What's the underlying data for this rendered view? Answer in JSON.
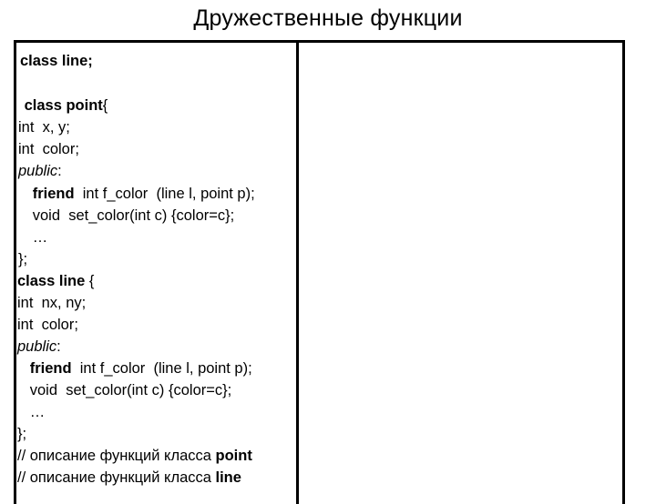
{
  "title": "Дружественные функции",
  "left_cell": {
    "lines": [
      {
        "parts": [
          {
            "text": "class line;",
            "style": "b"
          }
        ]
      },
      {
        "parts": [
          {
            "text": " class point",
            "style": "b"
          },
          {
            "text": "{",
            "style": ""
          }
        ]
      },
      {
        "parts": [
          {
            "text": "int  x, y;",
            "style": ""
          }
        ]
      },
      {
        "parts": [
          {
            "text": "int  color;",
            "style": ""
          }
        ]
      },
      {
        "parts": [
          {
            "text": "public",
            "style": "i"
          },
          {
            "text": ":",
            "style": ""
          }
        ]
      },
      {
        "parts": [
          {
            "text": "   friend",
            "style": "b"
          },
          {
            "text": "  int f_color  (line l, point p);",
            "style": ""
          }
        ]
      },
      {
        "parts": [
          {
            "text": "   void  set_color(int c) {color=c};",
            "style": ""
          }
        ]
      },
      {
        "parts": [
          {
            "text": "   …",
            "style": ""
          }
        ]
      },
      {
        "parts": [
          {
            "text": "};",
            "style": ""
          }
        ]
      },
      {
        "parts": [
          {
            "text": "class line",
            "style": "b"
          },
          {
            "text": " {",
            "style": ""
          }
        ]
      },
      {
        "parts": [
          {
            "text": "int  nx, ny;",
            "style": ""
          }
        ]
      },
      {
        "parts": [
          {
            "text": "int  color;",
            "style": ""
          }
        ]
      },
      {
        "parts": [
          {
            "text": "public",
            "style": "i"
          },
          {
            "text": ":",
            "style": ""
          }
        ]
      },
      {
        "parts": [
          {
            "text": "   friend",
            "style": "b"
          },
          {
            "text": "  int f_color  (line l, point p);",
            "style": ""
          }
        ]
      },
      {
        "parts": [
          {
            "text": "   void  set_color(int c) {color=c};",
            "style": ""
          }
        ]
      },
      {
        "parts": [
          {
            "text": "   …",
            "style": ""
          }
        ]
      },
      {
        "parts": [
          {
            "text": "};",
            "style": ""
          }
        ]
      },
      {
        "parts": [
          {
            "text": "// описание функций класса ",
            "style": ""
          },
          {
            "text": "point",
            "style": "b"
          }
        ]
      },
      {
        "parts": [
          {
            "text": "// описание функций класса ",
            "style": ""
          },
          {
            "text": "line",
            "style": "b"
          }
        ]
      }
    ]
  },
  "right_cell": {
    "text": ""
  }
}
